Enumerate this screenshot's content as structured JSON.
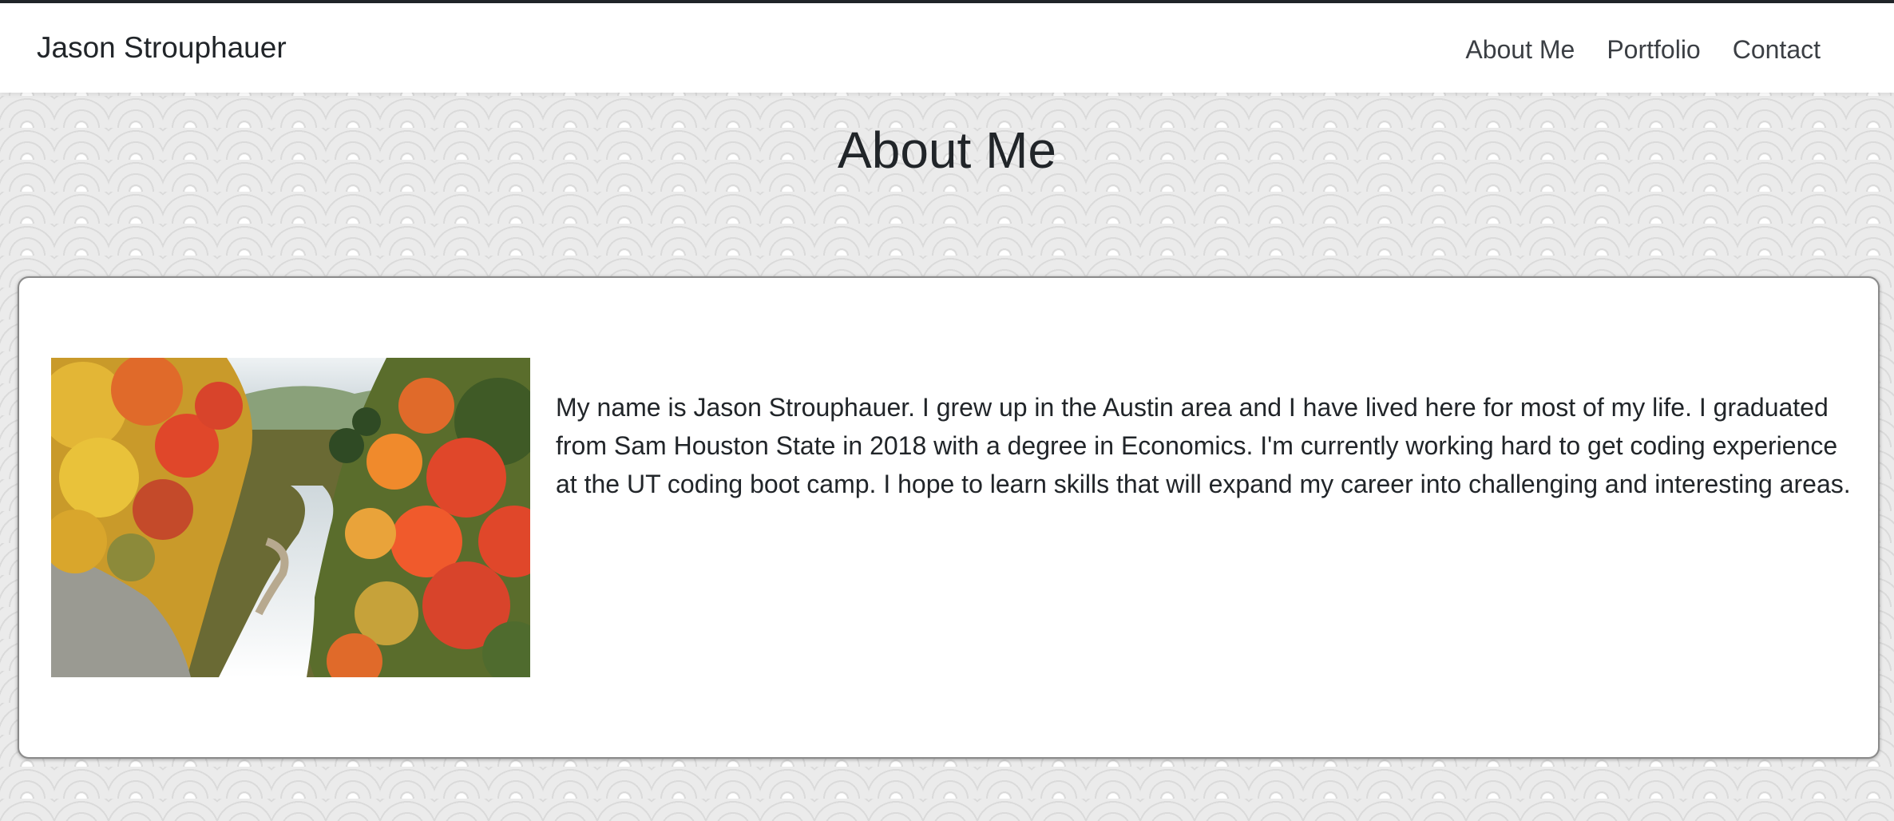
{
  "navbar": {
    "brand": "Jason Strouphauer",
    "links": [
      {
        "label": "About Me"
      },
      {
        "label": "Portfolio"
      },
      {
        "label": "Contact"
      }
    ]
  },
  "main": {
    "title": "About Me",
    "bio": "My name is Jason Strouphauer. I grew up in the Austin area and I have lived here for most of my life. I graduated from Sam Houston State in 2018 with a degree in Economics. I'm currently working hard to get coding experience at the UT coding boot camp. I hope to learn skills that will expand my career into challenging and interesting areas.",
    "photo": {
      "subject": "autumn-river-valley",
      "colors": {
        "sky": "#dfe6ea",
        "red": "#e0472a",
        "orange": "#f08a2c",
        "yellow": "#e9c23a",
        "green": "#4f6b2e",
        "river": "#f4f6f8",
        "rock": "#8f8f8f"
      }
    }
  },
  "colors": {
    "text": "#212529",
    "nav_text": "#3b3f44",
    "top_rule": "#212529",
    "card_border": "#8a8a8a"
  }
}
